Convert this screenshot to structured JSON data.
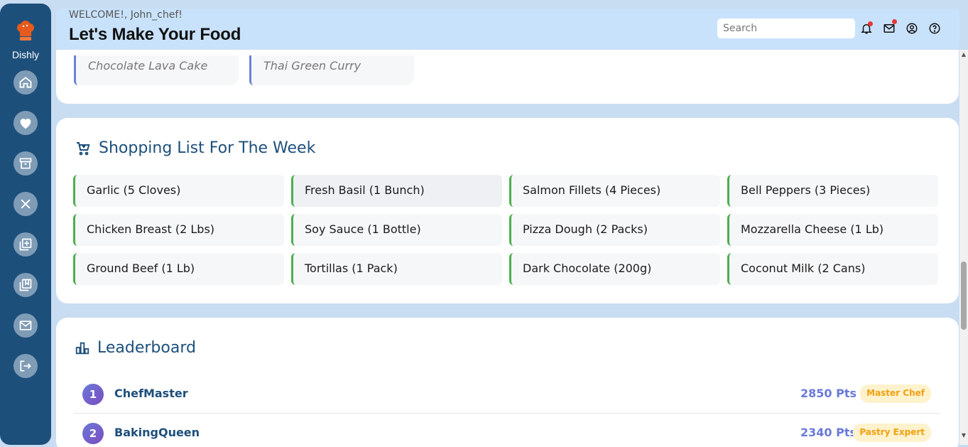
{
  "app": {
    "name": "Dishly"
  },
  "sidebar": {
    "items": [
      {
        "name": "home",
        "icon": "home-icon"
      },
      {
        "name": "favorites",
        "icon": "heart-icon"
      },
      {
        "name": "archive",
        "icon": "archive-icon"
      },
      {
        "name": "recipes",
        "icon": "utensils-icon"
      },
      {
        "name": "add-recipe",
        "icon": "add-box-icon"
      },
      {
        "name": "collections",
        "icon": "library-icon"
      },
      {
        "name": "messages",
        "icon": "mail-icon"
      },
      {
        "name": "logout",
        "icon": "logout-icon"
      }
    ]
  },
  "header": {
    "welcome": "WELCOME!, John_chef!",
    "title": "Let's Make Your Food",
    "search_placeholder": "Search"
  },
  "recipes_preview": {
    "items": [
      "Chocolate Lava Cake",
      "Thai Green Curry"
    ]
  },
  "shopping": {
    "title": "Shopping List For The Week",
    "items": [
      "Garlic (5 Cloves)",
      "Fresh Basil (1 Bunch)",
      "Salmon Fillets (4 Pieces)",
      "Bell Peppers (3 Pieces)",
      "Chicken Breast (2 Lbs)",
      "Soy Sauce (1 Bottle)",
      "Pizza Dough (2 Packs)",
      "Mozzarella Cheese (1 Lb)",
      "Ground Beef (1 Lb)",
      "Tortillas (1 Pack)",
      "Dark Chocolate (200g)",
      "Coconut Milk (2 Cans)"
    ]
  },
  "leaderboard": {
    "title": "Leaderboard",
    "rows": [
      {
        "rank": "1",
        "name": "ChefMaster",
        "points": "2850 Pts",
        "badge": "Master Chef"
      },
      {
        "rank": "2",
        "name": "BakingQueen",
        "points": "2340 Pts",
        "badge": "Pastry Expert"
      }
    ]
  },
  "colors": {
    "sidebar": "#1d4f7b",
    "accent": "#6a7ad8",
    "green": "#4caf50",
    "notification": "#e53935"
  }
}
